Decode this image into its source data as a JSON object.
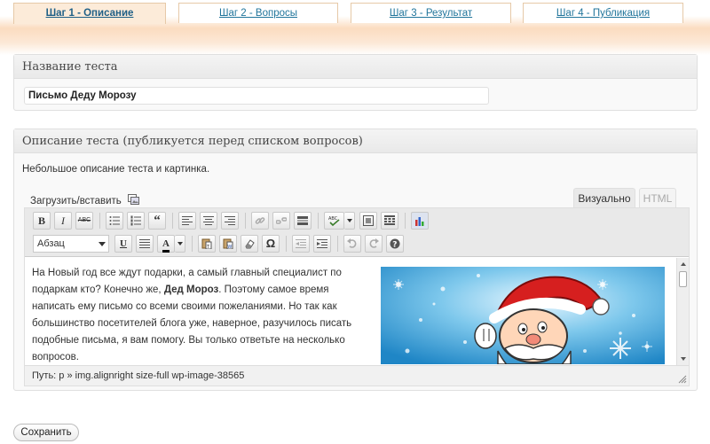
{
  "tabs": [
    {
      "label": "Шаг 1 - Описание",
      "active": true
    },
    {
      "label": "Шаг 2 - Вопросы",
      "active": false
    },
    {
      "label": "Шаг 3 - Результат",
      "active": false
    },
    {
      "label": "Шаг 4 - Публикация",
      "active": false
    }
  ],
  "title_panel": {
    "heading": "Название теста",
    "value": "Письмо Деду Морозу"
  },
  "description_panel": {
    "heading": "Описание теста (публикуется перед списком вопросов)",
    "hint": "Небольшое описание теста и картинка.",
    "upload_label": "Загрузить/вставить",
    "editor_tabs": {
      "visual": "Визуально",
      "html": "HTML"
    },
    "format_select": "Абзац",
    "toolbar_abc": "ABC",
    "content": {
      "part1": "На Новый год все ждут подарки, а самый главный специалист по подаркам кто? Конечно же, ",
      "bold": "Дед Мороз",
      "part2": ". Поэтому самое время написать ему письмо со всеми своими пожеланиями. Но так как большинство посетителей блога уже, наверное, разучилось писать подобные письма, я вам помогу. Вы только ответьте на несколько вопросов."
    },
    "path": "Путь: p » img.alignright size-full wp-image-38565"
  },
  "save_button": "Сохранить",
  "colors": {
    "link": "#21759b",
    "tab_band": "#fbdcc0",
    "panel_head": "#e9e9e9"
  }
}
